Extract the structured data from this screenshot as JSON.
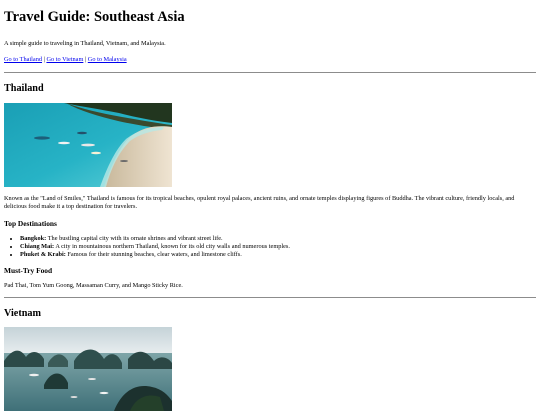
{
  "title": "Travel Guide: Southeast Asia",
  "intro": "A simple guide to traveling in Thailand, Vietnam, and Malaysia.",
  "nav": {
    "links": [
      "Go to Thailand",
      "Go to Vietnam",
      "Go to Malaysia"
    ],
    "separator": "|"
  },
  "thailand": {
    "heading": "Thailand",
    "image_alt": "tropical beach with turquoise water and boats",
    "description": "Known as the \"Land of Smiles,\" Thailand is famous for its tropical beaches, opulent royal palaces, ancient ruins, and ornate temples displaying figures of Buddha. The vibrant culture, friendly locals, and delicious food make it a top destination for travelers.",
    "destinations_heading": "Top Destinations",
    "destinations": [
      {
        "name": "Bangkok:",
        "text": " The bustling capital city with its ornate shrines and vibrant street life."
      },
      {
        "name": "Chiang Mai:",
        "text": " A city in mountainous northern Thailand, known for its old city walls and numerous temples."
      },
      {
        "name": "Phuket & Krabi:",
        "text": " Famous for their stunning beaches, clear waters, and limestone cliffs."
      }
    ],
    "food_heading": "Must-Try Food",
    "food": "Pad Thai, Tom Yum Goong, Massaman Curry, and Mango Sticky Rice."
  },
  "vietnam": {
    "heading": "Vietnam",
    "image_alt": "bay with limestone karst islands and boats"
  },
  "colors": {
    "link": "#0000ee",
    "rule": "#8c8c8c",
    "sea": "#27b3c6",
    "sand": "#d9cbb5",
    "bay_water": "#4d7f86"
  },
  "icons": []
}
